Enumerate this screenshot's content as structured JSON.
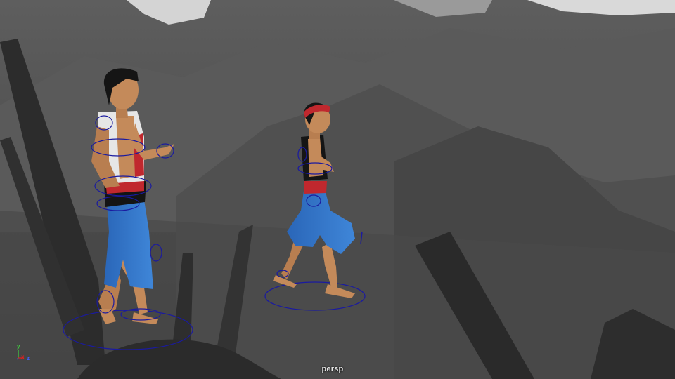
{
  "viewport": {
    "camera": "persp",
    "background_color": "#4a4a4a"
  },
  "axis_gizmo": {
    "y_label": "y",
    "x_label": "x",
    "z_label": "z",
    "colors": {
      "x": "#e02020",
      "y": "#40d040",
      "z": "#4060ff"
    }
  },
  "colors": {
    "rig_control": "#1a1aa0",
    "skin": "#c48a5a",
    "pants": "#2f6fc0",
    "sash": "#c0282e"
  }
}
